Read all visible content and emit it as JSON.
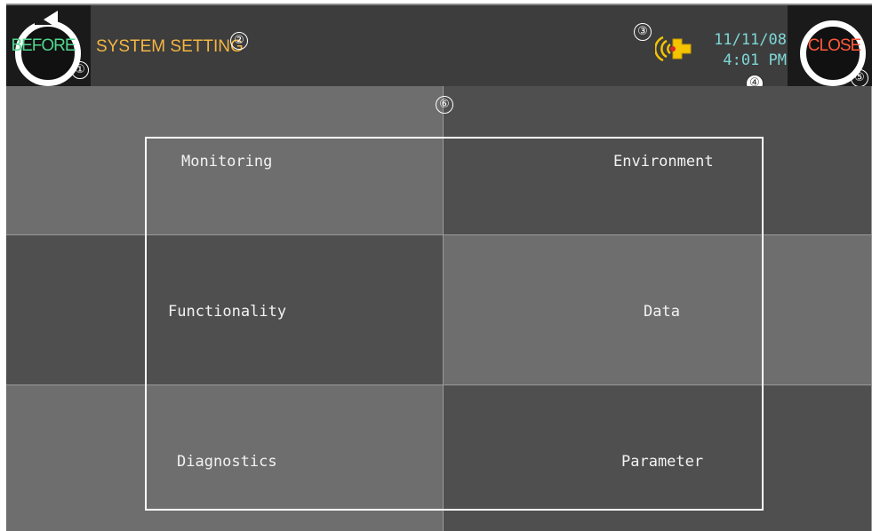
{
  "header": {
    "before_label": "BEFORE",
    "title": "SYSTEM SETTING",
    "close_label": "CLOSE",
    "date": "11/11/08",
    "time": "4:01 PM"
  },
  "callouts": [
    "①",
    "②",
    "③",
    "④",
    "⑤",
    "⑥"
  ],
  "menu": {
    "monitoring": "Monitoring",
    "environment": "Environment",
    "functionality": "Functionality",
    "data": "Data",
    "diagnostics": "Diagnostics",
    "parameter": "Parameter"
  },
  "icons": {
    "before": "rotate-back-icon",
    "close": "close-ring-icon",
    "alarm": "alarm-bell-icon"
  },
  "colors": {
    "before_text": "#4fd68e",
    "title_text": "#f3b642",
    "close_text": "#ff5a3c",
    "datetime_text": "#7ed6d6",
    "alarm_icon": "#f5c400"
  }
}
